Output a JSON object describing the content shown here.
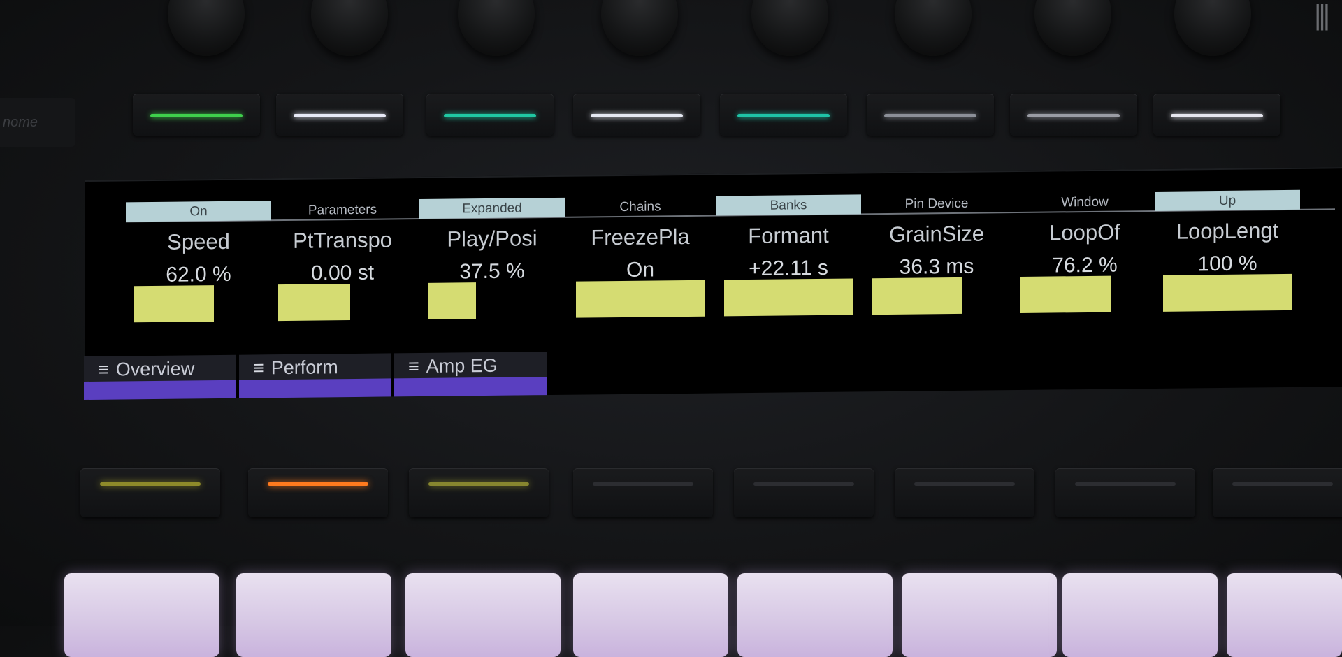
{
  "side_label": "nome",
  "top_buttons": [
    {
      "led_color": "#3fcf4c"
    },
    {
      "led_color": "#e7e9f6"
    },
    {
      "led_color": "#20c7a2"
    },
    {
      "led_color": "#e5e8f2"
    },
    {
      "led_color": "#1fc2a6"
    },
    {
      "led_color": "#8c8f98"
    },
    {
      "led_color": "#9a9ca4"
    },
    {
      "led_color": "#e6e6ee"
    }
  ],
  "top_tabs": [
    {
      "label": "On",
      "active": true
    },
    {
      "label": "Parameters",
      "active": false
    },
    {
      "label": "Expanded",
      "active": true
    },
    {
      "label": "Chains",
      "active": false
    },
    {
      "label": "Banks",
      "active": true
    },
    {
      "label": "Pin Device",
      "active": false
    },
    {
      "label": "Window",
      "active": false
    },
    {
      "label": "Up",
      "active": true
    }
  ],
  "parameters": [
    {
      "name": "Speed",
      "value": "62.0 %"
    },
    {
      "name": "PtTranspo",
      "value": "0.00 st"
    },
    {
      "name": "Play/Posi",
      "value": "37.5 %"
    },
    {
      "name": "FreezePla",
      "value": "On"
    },
    {
      "name": "Formant",
      "value": "+22.11 s"
    },
    {
      "name": "GrainSize",
      "value": "36.3 ms"
    },
    {
      "name": "LoopOf",
      "value": "76.2 %"
    },
    {
      "name": "LoopLengt",
      "value": "100 %"
    }
  ],
  "meters": [
    {
      "level": 0.62
    },
    {
      "level": 0.56
    },
    {
      "level": 0.375
    },
    {
      "level": 1.0
    },
    {
      "level": 1.0
    },
    {
      "level": 0.7
    },
    {
      "level": 0.7
    },
    {
      "level": 1.0
    }
  ],
  "banks": [
    {
      "icon": "bank-icon",
      "label": "Overview"
    },
    {
      "icon": "bank-icon",
      "label": "Perform"
    },
    {
      "icon": "bank-icon",
      "label": "Amp EG"
    }
  ],
  "bottom_buttons": [
    {
      "led_color": "#8e8a2a"
    },
    {
      "led_color": "#ff7a1e"
    },
    {
      "led_color": "#87862f"
    },
    {
      "led_color": "#2c2d31"
    },
    {
      "led_color": "#2c2d31"
    },
    {
      "led_color": "#2c2d31"
    },
    {
      "led_color": "#2c2d31"
    },
    {
      "led_color": "#2c2d31"
    }
  ],
  "colors": {
    "meter_fill": "#d5dc72",
    "tab_active_bg": "#b6d1d6",
    "bank_bar": "#5a3fc0",
    "pad": "#d9c9e6"
  }
}
